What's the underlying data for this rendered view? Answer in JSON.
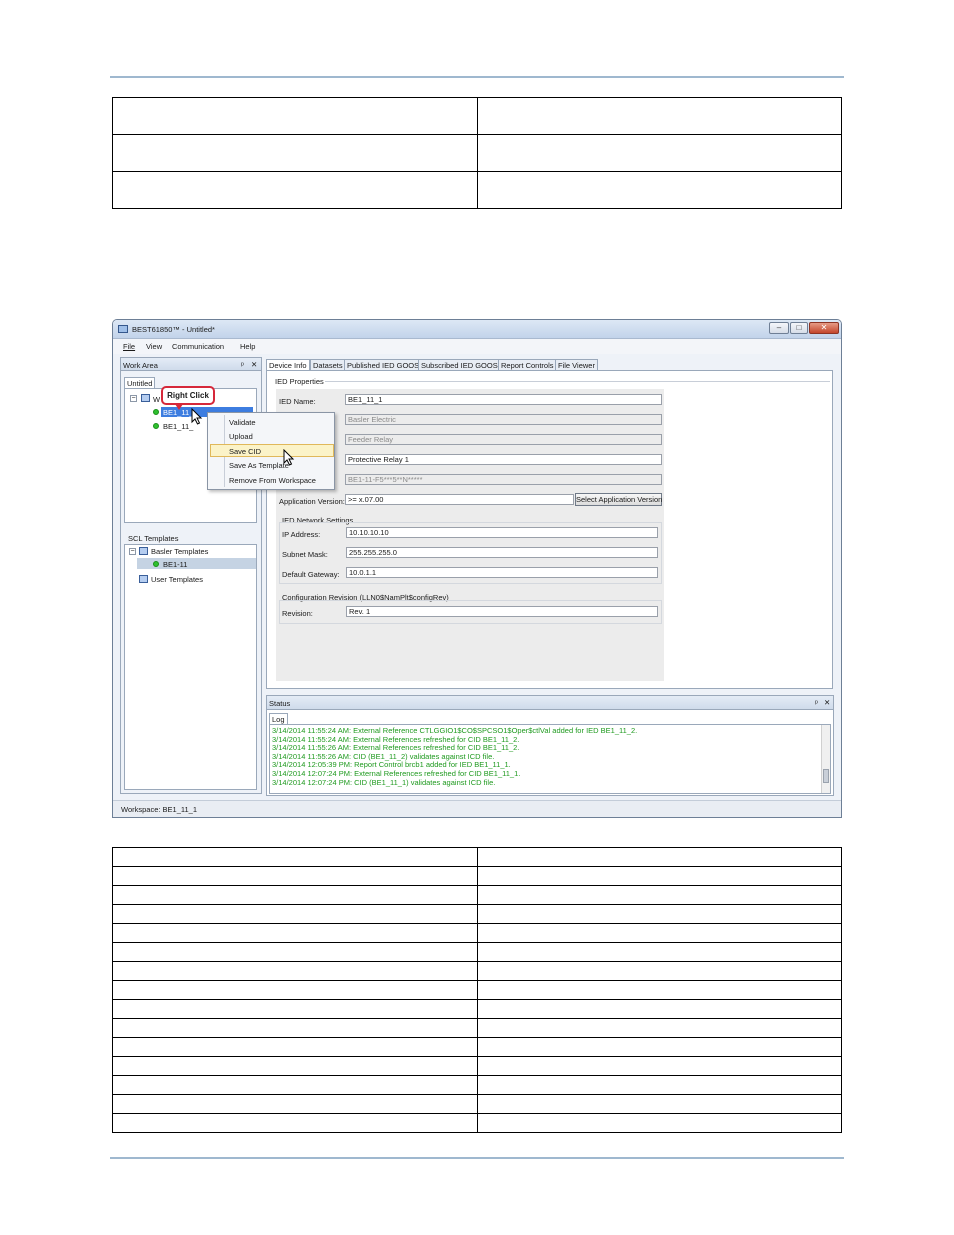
{
  "window": {
    "title": "BEST61850™ - Untitled*",
    "controls": [
      "–",
      "□",
      "✕"
    ],
    "status_bar": "Workspace: BE1_11_1"
  },
  "menu": [
    "File",
    "View",
    "Communication",
    "Help"
  ],
  "work_area": {
    "title": "Work Area",
    "pin": "ᵖ",
    "close": "✕",
    "tab": "Untitled",
    "root_label": "W",
    "items": [
      "BE1_11_",
      "BE1_11_"
    ]
  },
  "callout": "Right Click",
  "context_menu": [
    "Validate",
    "Upload",
    "Save CID",
    "Save As Template",
    "Remove From Workspace"
  ],
  "templates": {
    "title": "SCL Templates",
    "basler": "Basler Templates",
    "item": "BE1-11",
    "user": "User Templates"
  },
  "tabs": [
    "Device Info",
    "Datasets",
    "Published IED GOOSE",
    "Subscribed IED GOOSE",
    "Report Controls",
    "File Viewer"
  ],
  "ied": {
    "group": "IED Properties",
    "name_label": "IED Name:",
    "name": "BE1_11_1",
    "manufacturer": "Basler Electric",
    "type": "Feeder Relay",
    "desc": "Protective Relay 1",
    "style": "BE1-11-F5***5**N*****",
    "app_version_label": "Application Version:",
    "app_version": ">= x.07.00",
    "select_button": "Select Application Version"
  },
  "network": {
    "title": "IED Network Settings",
    "ip_label": "IP Address:",
    "ip": "10.10.10.10",
    "mask_label": "Subnet Mask:",
    "mask": "255.255.255.0",
    "gateway_label": "Default Gateway:",
    "gateway": "10.0.1.1"
  },
  "config": {
    "title": "Configuration Revision (LLN0$NamPlt$configRev)",
    "revision_label": "Revision:",
    "revision": "Rev. 1"
  },
  "status": {
    "title": "Status",
    "tab": "Log",
    "lines": [
      "3/14/2014 11:55:24 AM: External Reference CTLGGIO1$CO$SPCSO1$Oper$ctlVal added for IED BE1_11_2.",
      "3/14/2014 11:55:24 AM: External References refreshed for CID BE1_11_2.",
      "3/14/2014 11:55:26 AM: External References refreshed for CID BE1_11_2.",
      "3/14/2014 11:55:26 AM: CID (BE1_11_2) validates against ICD file.",
      "3/14/2014 12:05:39 PM: Report Control brcb1 added for IED BE1_11_1.",
      "3/14/2014 12:07:24 PM: External References refreshed for CID BE1_11_1.",
      "3/14/2014 12:07:24 PM: CID (BE1_11_1) validates against ICD file."
    ]
  }
}
